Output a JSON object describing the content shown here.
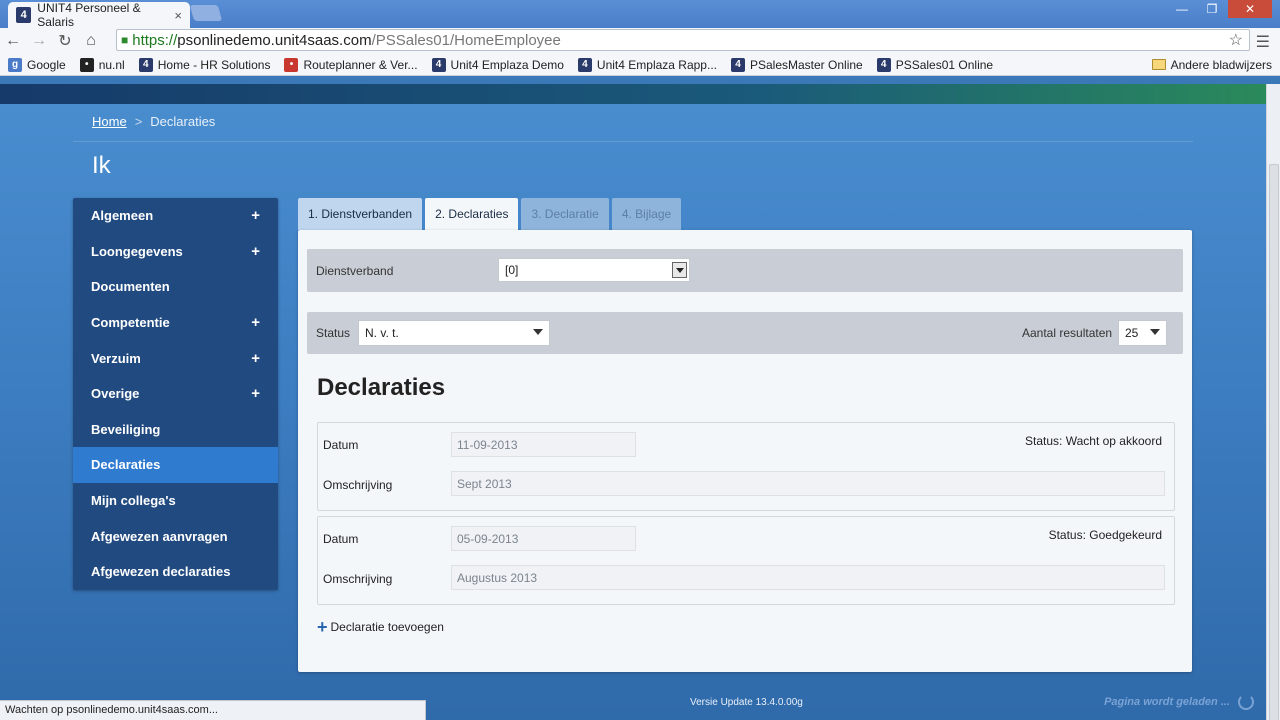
{
  "browser": {
    "tab_title": "UNIT4 Personeel & Salaris",
    "tab_close": "×",
    "url_https": "https://",
    "url_host": "psonlinedemo.unit4saas.com",
    "url_path": "/PSSales01/HomeEmployee",
    "bookmarks": [
      {
        "label": "Google",
        "icon": "google-icon",
        "color": "#4a7ac8",
        "glyph": "g"
      },
      {
        "label": "nu.nl",
        "icon": "nu-icon",
        "color": "#222222",
        "glyph": "•"
      },
      {
        "label": "Home - HR Solutions",
        "icon": "unit4-icon",
        "color": "#2a3a6a",
        "glyph": "4"
      },
      {
        "label": "Routeplanner & Ver...",
        "icon": "routeplanner-icon",
        "color": "#c8382e",
        "glyph": "•"
      },
      {
        "label": "Unit4 Emplaza Demo",
        "icon": "unit4-icon",
        "color": "#2a3a6a",
        "glyph": "4"
      },
      {
        "label": "Unit4 Emplaza Rapp...",
        "icon": "unit4-icon",
        "color": "#2a3a6a",
        "glyph": "4"
      },
      {
        "label": "PSalesMaster Online",
        "icon": "unit4-icon",
        "color": "#2a3a6a",
        "glyph": "4"
      },
      {
        "label": "PSSales01 Online",
        "icon": "unit4-icon",
        "color": "#2a3a6a",
        "glyph": "4"
      }
    ],
    "other_bookmarks": "Andere bladwijzers",
    "status_text": "Wachten op psonlinedemo.unit4saas.com..."
  },
  "breadcrumb": {
    "home": "Home",
    "sep": ">",
    "current": "Declaraties"
  },
  "page_title": "Ik",
  "sidebar": {
    "items": [
      {
        "label": "Algemeen",
        "plus": "+",
        "active": false
      },
      {
        "label": "Loongegevens",
        "plus": "+",
        "active": false
      },
      {
        "label": "Documenten",
        "plus": "",
        "active": false
      },
      {
        "label": "Competentie",
        "plus": "+",
        "active": false
      },
      {
        "label": "Verzuim",
        "plus": "+",
        "active": false
      },
      {
        "label": "Overige",
        "plus": "+",
        "active": false
      },
      {
        "label": "Beveiliging",
        "plus": "",
        "active": false
      },
      {
        "label": "Declaraties",
        "plus": "",
        "active": true
      },
      {
        "label": "Mijn collega's",
        "plus": "",
        "active": false
      },
      {
        "label": "Afgewezen aanvragen",
        "plus": "",
        "active": false
      },
      {
        "label": "Afgewezen declaraties",
        "plus": "",
        "active": false
      }
    ]
  },
  "wizard_tabs": [
    {
      "label": "1. Dienstverbanden",
      "state": "normal"
    },
    {
      "label": "2. Declaraties",
      "state": "selected"
    },
    {
      "label": "3. Declaratie",
      "state": "disabled"
    },
    {
      "label": "4. Bijlage",
      "state": "disabled"
    }
  ],
  "filters": {
    "dienstverband_label": "Dienstverband",
    "dienstverband_value": "[0]",
    "status_label": "Status",
    "status_value": "N. v. t.",
    "results_label": "Aantal resultaten",
    "results_value": "25"
  },
  "section_title": "Declaraties",
  "records": [
    {
      "datum_label": "Datum",
      "datum": "11-09-2013",
      "omschrijving_label": "Omschrijving",
      "omschrijving": "Sept 2013",
      "status": "Status: Wacht op akkoord"
    },
    {
      "datum_label": "Datum",
      "datum": "05-09-2013",
      "omschrijving_label": "Omschrijving",
      "omschrijving": "Augustus 2013",
      "status": "Status: Goedgekeurd"
    }
  ],
  "add_label": "Declaratie toevoegen",
  "version": "Versie Update 13.4.0.00g",
  "loading": "Pagina wordt geladen ..."
}
